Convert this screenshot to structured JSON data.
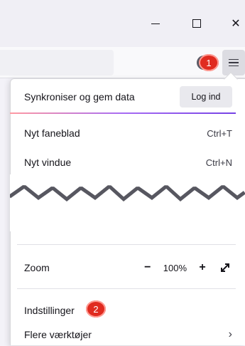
{
  "window": {
    "minimize_glyph": "",
    "maximize_glyph": "",
    "close_glyph": "✕"
  },
  "annotations": {
    "badge_1": "1",
    "badge_2": "2"
  },
  "menu": {
    "sync_label": "Synkroniser og gem data",
    "login_button": "Log ind",
    "items": [
      {
        "label": "Nyt faneblad",
        "shortcut": "Ctrl+T"
      },
      {
        "label": "Nyt vindue",
        "shortcut": "Ctrl+N"
      }
    ],
    "zoom": {
      "label": "Zoom",
      "minus": "−",
      "value": "100%",
      "plus": "+",
      "fullscreen_icon": "fullscreen-icon"
    },
    "settings_label": "Indstillinger",
    "tools_label": "Flere værktøjer",
    "tools_chevron": "›"
  },
  "colors": {
    "badge": "#e02b20",
    "accent_gradient_start": "#ff9aa2",
    "accent_gradient_end": "#7542e5"
  }
}
